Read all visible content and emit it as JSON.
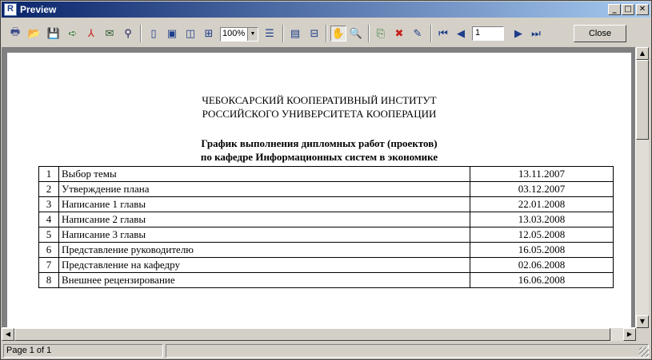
{
  "window": {
    "title": "Preview"
  },
  "toolbar": {
    "zoom": "100%",
    "page_input": "1",
    "close_label": "Close",
    "icons": [
      "print",
      "open",
      "save",
      "export",
      "pdf",
      "email",
      "find",
      "one-page",
      "page-width",
      "two-pages",
      "four-pages",
      "zoom",
      "outline",
      "thumbnails",
      "hand",
      "magnifier",
      "add-page",
      "delete-page",
      "edit-page",
      "first-page",
      "prev-page",
      "next-page",
      "last-page"
    ]
  },
  "document": {
    "header_line1": "ЧЕБОКСАРСКИЙ КООПЕРАТИВНЫЙ ИНСТИТУТ",
    "header_line2": "РОССИЙСКОГО УНИВЕРСИТЕТА КООПЕРАЦИИ",
    "title_line1": "График выполнения дипломных работ (проектов)",
    "title_line2": "по кафедре Информационных систем в экономике",
    "rows": [
      {
        "num": "1",
        "task": "Выбор темы",
        "date": "13.11.2007"
      },
      {
        "num": "2",
        "task": "Утверждение плана",
        "date": "03.12.2007"
      },
      {
        "num": "3",
        "task": "Написание 1 главы",
        "date": "22.01.2008"
      },
      {
        "num": "4",
        "task": "Написание 2 главы",
        "date": "13.03.2008"
      },
      {
        "num": "5",
        "task": "Написание 3 главы",
        "date": "12.05.2008"
      },
      {
        "num": "6",
        "task": "Представление руководителю",
        "date": "16.05.2008"
      },
      {
        "num": "7",
        "task": "Представление на кафедру",
        "date": "02.06.2008"
      },
      {
        "num": "8",
        "task": "Внешнее рецензирование",
        "date": "16.06.2008"
      }
    ]
  },
  "status": {
    "page_info": "Page 1 of 1"
  }
}
